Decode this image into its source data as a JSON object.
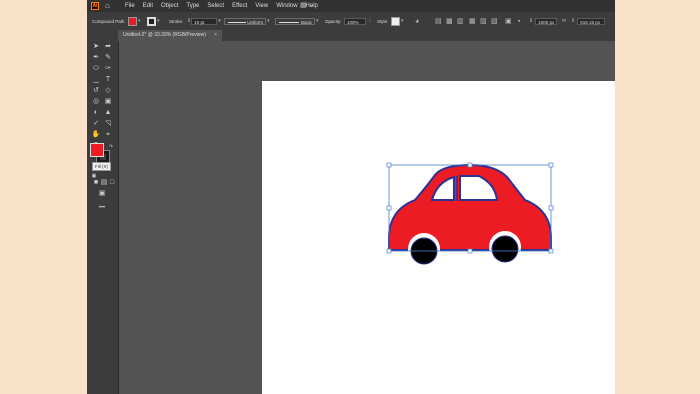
{
  "menubar": {
    "items": [
      "File",
      "Edit",
      "Object",
      "Type",
      "Select",
      "Effect",
      "View",
      "Window",
      "Help"
    ]
  },
  "controlbar": {
    "selection": "Compound Path",
    "stroke_label": "Stroke:",
    "stroke_value": "10 pt",
    "profile": "Uniform",
    "brush": "Basic",
    "opacity_label": "Opacity:",
    "opacity_value": "100%",
    "style_label": "Style:",
    "width_value": "1000 px",
    "height_value": "616.15 px"
  },
  "document": {
    "tab_title": "Untitled-2* @ 33.33% (RGB/Preview)"
  },
  "tooltip": "Fill (X)",
  "colors": {
    "fill": "#ed1c24",
    "car_body": "#ed1c24",
    "car_outline": "#2e3192",
    "wheel": "#000000",
    "selection": "#4a7bd1"
  }
}
